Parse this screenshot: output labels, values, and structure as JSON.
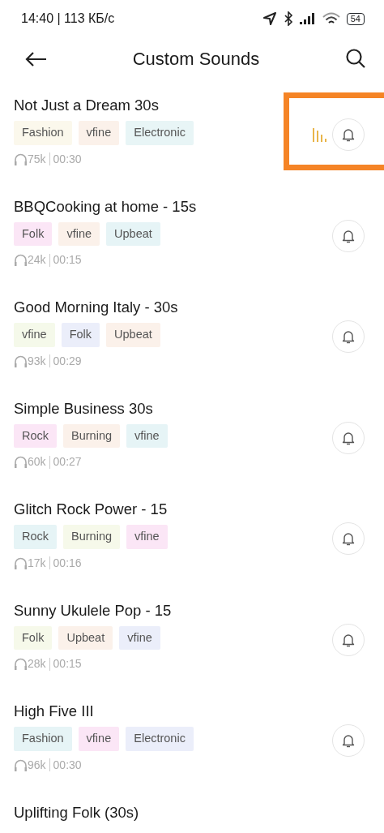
{
  "status_bar": {
    "time": "14:40 | 113 КБ/с",
    "battery": "54"
  },
  "header": {
    "title": "Custom Sounds"
  },
  "sounds": [
    {
      "title": "Not Just a Dream 30s",
      "tags": [
        {
          "label": "Fashion",
          "color": "#fbf8ec"
        },
        {
          "label": "vfine",
          "color": "#fbf1ea"
        },
        {
          "label": "Electronic",
          "color": "#e8f5f6"
        }
      ],
      "plays": "75k",
      "duration": "00:30",
      "playing": true,
      "highlighted": true
    },
    {
      "title": "BBQCooking at home - 15s",
      "tags": [
        {
          "label": "Folk",
          "color": "#fbe6f6"
        },
        {
          "label": "vfine",
          "color": "#fbf1ea"
        },
        {
          "label": "Upbeat",
          "color": "#e6f4f6"
        }
      ],
      "plays": "24k",
      "duration": "00:15",
      "playing": false,
      "highlighted": false
    },
    {
      "title": "Good Morning Italy - 30s",
      "tags": [
        {
          "label": "vfine",
          "color": "#f5f9ea"
        },
        {
          "label": "Folk",
          "color": "#ebeefa"
        },
        {
          "label": "Upbeat",
          "color": "#fbf1ea"
        }
      ],
      "plays": "93k",
      "duration": "00:29",
      "playing": false,
      "highlighted": false
    },
    {
      "title": "Simple Business 30s",
      "tags": [
        {
          "label": "Rock",
          "color": "#fbe6f6"
        },
        {
          "label": "Burning",
          "color": "#fbf1ea"
        },
        {
          "label": "vfine",
          "color": "#e6f4f6"
        }
      ],
      "plays": "60k",
      "duration": "00:27",
      "playing": false,
      "highlighted": false
    },
    {
      "title": "Glitch Rock Power - 15",
      "tags": [
        {
          "label": "Rock",
          "color": "#e6f4f6"
        },
        {
          "label": "Burning",
          "color": "#f6f9ea"
        },
        {
          "label": "vfine",
          "color": "#fbe6f6"
        }
      ],
      "plays": "17k",
      "duration": "00:16",
      "playing": false,
      "highlighted": false
    },
    {
      "title": "Sunny Ukulele Pop - 15",
      "tags": [
        {
          "label": "Folk",
          "color": "#f6f9ea"
        },
        {
          "label": "Upbeat",
          "color": "#fbf1ea"
        },
        {
          "label": "vfine",
          "color": "#ebeefa"
        }
      ],
      "plays": "28k",
      "duration": "00:15",
      "playing": false,
      "highlighted": false
    },
    {
      "title": "High Five III",
      "tags": [
        {
          "label": "Fashion",
          "color": "#e6f4f6"
        },
        {
          "label": "vfine",
          "color": "#fbe6f6"
        },
        {
          "label": "Electronic",
          "color": "#ebeefa"
        }
      ],
      "plays": "96k",
      "duration": "00:30",
      "playing": false,
      "highlighted": false
    },
    {
      "title": "Uplifting Folk (30s)"
    }
  ]
}
